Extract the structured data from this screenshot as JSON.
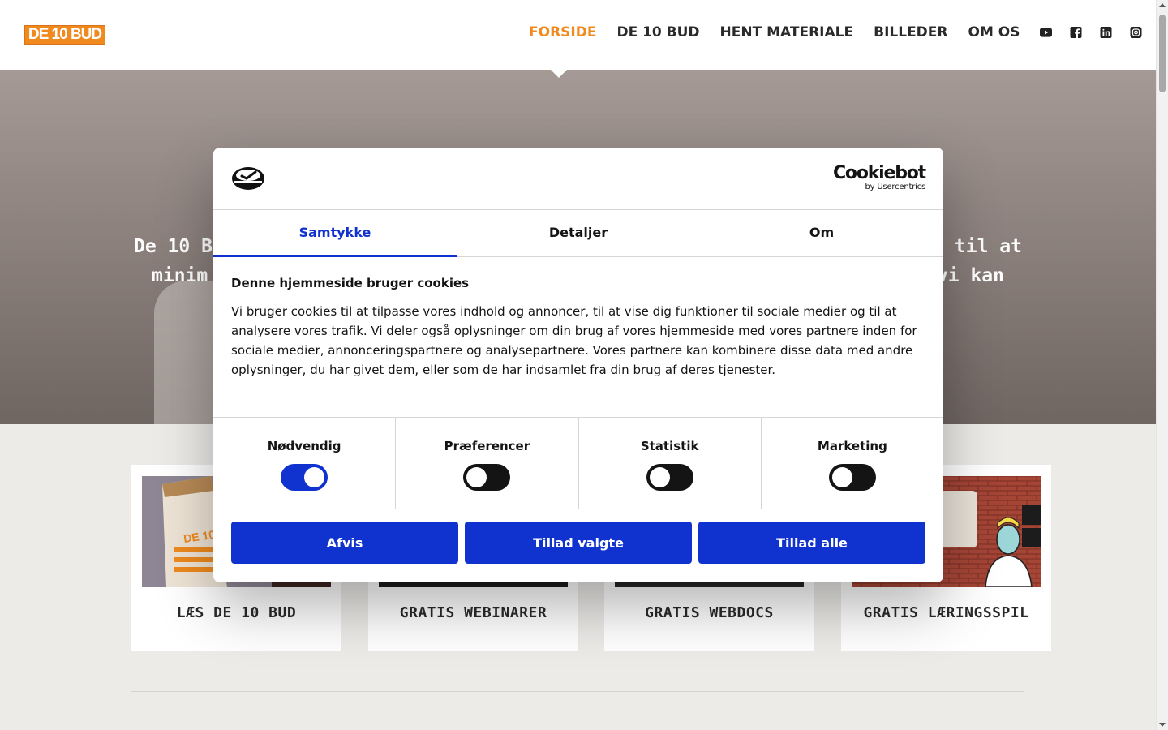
{
  "header": {
    "logo_text": "DE 10 BUD",
    "nav": [
      {
        "label": "FORSIDE",
        "active": true
      },
      {
        "label": "DE 10 BUD",
        "active": false
      },
      {
        "label": "HENT MATERIALE",
        "active": false
      },
      {
        "label": "BILLEDER",
        "active": false
      },
      {
        "label": "OM OS",
        "active": false
      }
    ],
    "social_icons": [
      "youtube-icon",
      "facebook-icon",
      "linkedin-icon",
      "instagram-icon"
    ],
    "accent_color": "#f08a1e"
  },
  "hero": {
    "text_line1_left": "De 10 B",
    "text_line1_right": "til at",
    "text_line2_left": "minim",
    "text_line2_right": "vi kan"
  },
  "cards": [
    {
      "label": "LÆS DE 10 BUD"
    },
    {
      "label": "GRATIS WEBINARER"
    },
    {
      "label": "GRATIS WEBDOCS"
    },
    {
      "label": "GRATIS LÆRINGSSPIL"
    }
  ],
  "cookie_dialog": {
    "brand_name": "Cookiebot",
    "brand_sub": "by Usercentrics",
    "tabs": [
      {
        "label": "Samtykke",
        "active": true
      },
      {
        "label": "Detaljer",
        "active": false
      },
      {
        "label": "Om",
        "active": false
      }
    ],
    "title": "Denne hjemmeside bruger cookies",
    "body": "Vi bruger cookies til at tilpasse vores indhold og annoncer, til at vise dig funktioner til sociale medier og til at analysere vores trafik. Vi deler også oplysninger om din brug af vores hjemmeside med vores partnere inden for sociale medier, annonceringspartnere og analysepartnere. Vores partnere kan kombinere disse data med andre oplysninger, du har givet dem, eller som de har indsamlet fra din brug af deres tjenester.",
    "categories": [
      {
        "label": "Nødvendig",
        "enabled": true
      },
      {
        "label": "Præferencer",
        "enabled": false
      },
      {
        "label": "Statistik",
        "enabled": false
      },
      {
        "label": "Marketing",
        "enabled": false
      }
    ],
    "buttons": {
      "deny": "Afvis",
      "allow_selected": "Tillad valgte",
      "allow_all": "Tillad alle"
    },
    "accent_color": "#1032cf"
  }
}
